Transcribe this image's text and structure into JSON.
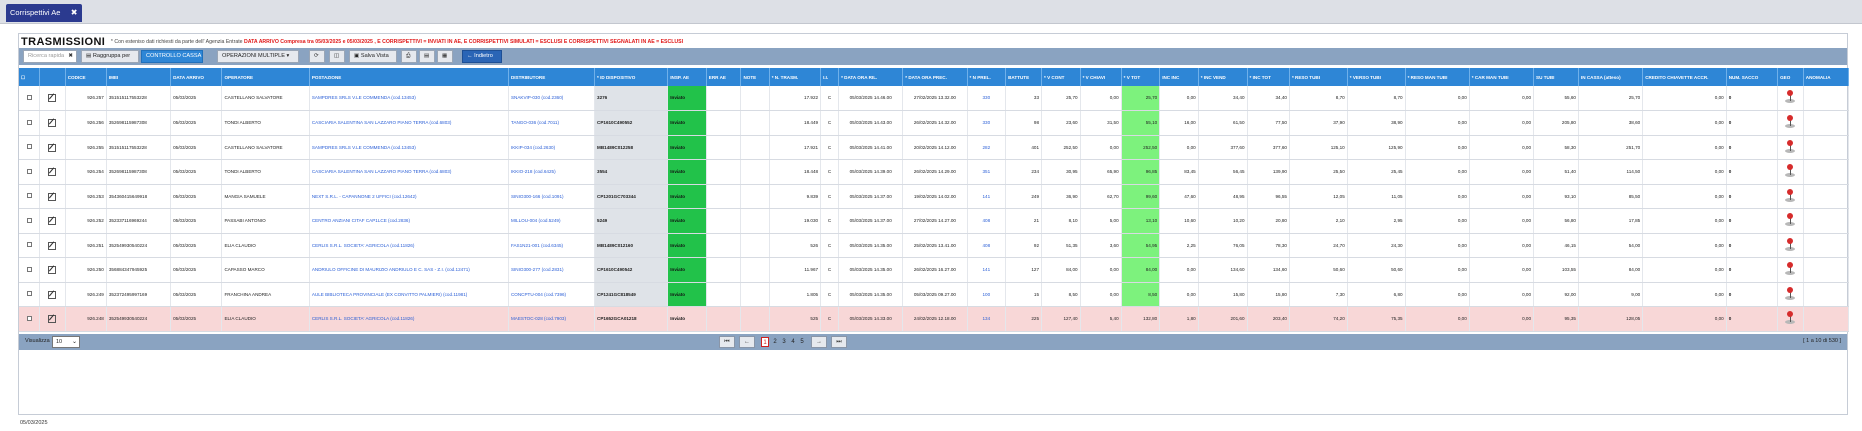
{
  "tab": {
    "label": "Corrispettivi Ae",
    "close": "✖"
  },
  "title": "TRASMISSIONI",
  "subtitle": {
    "prefix": "* Con esteniso dati richiesti da parte dell' Agenzia Entrate",
    "red": "DATA ARRIVO Compresa tra 05/03/2025 e 05/03/2025 , E CORRISPETTIVI = INVIATI IN AE, E CORRISPETTIVI SIMULATI = ESCLUSI E CORRISPETTIVI SEGNALATI IN AE = ESCLUSI"
  },
  "toolbar": {
    "search_placeholder": "Ricerca rapida",
    "search_clear": "✖",
    "group_by": "Raggruppa per",
    "cash_control": "CONTROLLO CASSA",
    "multi_ops": "OPERAZIONI MULTIPLE ▾",
    "refresh": "⟳",
    "columns": "◫",
    "save_view": "Salva Vista",
    "print": "⎙",
    "pdf": "▤",
    "excel": "▦",
    "back": "← Indietro"
  },
  "columns": [
    "☐",
    "",
    "CODICE",
    "IMEI",
    "DATA ARRIVO",
    "OPERATORE",
    "POSTAZIONE",
    "DISTRIBUTORE",
    "* ID DISPOSITIVO",
    "INSP. AE",
    "ERR AE",
    "NOTE",
    "* N. TRASM.",
    "I.I.",
    "* DATA ORA RIL.",
    "* DATA ORA PREC.",
    "* N PREL.",
    "BATTUTE",
    "* V CONT",
    "* V CHIAVI",
    "* V TOT",
    "INC INC",
    "* INC VEND",
    "* INC TOT",
    "* RESO TUBI",
    "* VERSO TUBI",
    "* RESO MAN TUBI",
    "* CAR MAN TUBI",
    "SU TUBI",
    "IN CASSA (atteso)",
    "CREDITO CHIAVETTE ACCR.",
    "NUM. SACCO",
    "GEO",
    "ANOMALIA"
  ],
  "rows": [
    {
      "codice": "926.257",
      "imei": "351515117553228",
      "data": "05/03/2025",
      "operatore": "CASTELLANO SALVATORE",
      "postazione": "SAMPDRES SRLS V.LE COMMENDA (cod.13453)",
      "distributore": "SNAKVIP-030 (cod.2360)",
      "dispositivo": "3276",
      "stato": "Inviato",
      "ntrasm": "17.922",
      "ii": "C",
      "dataril": "05/03/2025 14.46.00",
      "dataprec": "27/02/2025 13.32.00",
      "nprel": "330",
      "battute": "33",
      "vcont": "25,70",
      "vchiavi": "0,00",
      "vtot": "25,70",
      "incinc": "0,00",
      "incvend": "34,40",
      "inctot": "34,40",
      "resotubi": "8,70",
      "versotubi": "8,70",
      "resoman": "0,00",
      "carman": "0,00",
      "sutubi": "55,60",
      "incassa": "25,70",
      "credito": "0,00",
      "sacco": "0"
    },
    {
      "codice": "926.256",
      "imei": "352698115987308",
      "data": "05/03/2025",
      "operatore": "TONDI ALBERTO",
      "postazione": "CASCIARIA SALENTINA SAN LAZZARO PIANO TERRA (cod.6803)",
      "distributore": "TANGO-036 (cod.7011)",
      "dispositivo": "CP1610C490552",
      "stato": "Inviato",
      "ntrasm": "18.449",
      "ii": "C",
      "dataril": "05/03/2025 14.43.00",
      "dataprec": "26/02/2025 14.32.00",
      "nprel": "330",
      "battute": "98",
      "vcont": "23,60",
      "vchiavi": "31,50",
      "vtot": "55,10",
      "incinc": "16,00",
      "incvend": "61,50",
      "inctot": "77,50",
      "resotubi": "37,90",
      "versotubi": "38,90",
      "resoman": "0,00",
      "carman": "0,00",
      "sutubi": "205,80",
      "incassa": "38,60",
      "credito": "0,00",
      "sacco": "0"
    },
    {
      "codice": "926.255",
      "imei": "351515117553228",
      "data": "05/03/2025",
      "operatore": "CASTELLANO SALVATORE",
      "postazione": "SAMPDRES SRLS V.LE COMMENDA (cod.13453)",
      "distributore": "IKKIP-034 (cod.2630)",
      "dispositivo": "MB1489C012258",
      "stato": "Inviato",
      "ntrasm": "17.921",
      "ii": "C",
      "dataril": "05/03/2025 14.41.00",
      "dataprec": "20/02/2025 14.12.00",
      "nprel": "282",
      "battute": "401",
      "vcont": "252,50",
      "vchiavi": "0,00",
      "vtot": "252,50",
      "incinc": "0,00",
      "incvend": "377,60",
      "inctot": "377,60",
      "resotubi": "125,10",
      "versotubi": "125,90",
      "resoman": "0,00",
      "carman": "0,00",
      "sutubi": "58,30",
      "incassa": "251,70",
      "credito": "0,00",
      "sacco": "0"
    },
    {
      "codice": "926.254",
      "imei": "352698115987308",
      "data": "05/03/2025",
      "operatore": "TONDI ALBERTO",
      "postazione": "CASCIARIA SALENTINA SAN LAZZARO PIANO TERRA (cod.6803)",
      "distributore": "IKKIO-218 (cod.6425)",
      "dispositivo": "3554",
      "stato": "Inviato",
      "ntrasm": "18.448",
      "ii": "C",
      "dataril": "05/03/2025 14.39.00",
      "dataprec": "26/02/2025 14.29.00",
      "nprel": "351",
      "battute": "234",
      "vcont": "30,95",
      "vchiavi": "65,90",
      "vtot": "96,85",
      "incinc": "83,45",
      "incvend": "56,45",
      "inctot": "139,90",
      "resotubi": "25,50",
      "versotubi": "25,45",
      "resoman": "0,00",
      "carman": "0,00",
      "sutubi": "51,40",
      "incassa": "114,50",
      "credito": "0,00",
      "sacco": "0"
    },
    {
      "codice": "926.253",
      "imei": "354360415649918",
      "data": "05/03/2025",
      "operatore": "MANGIA SAMUELE",
      "postazione": "NEXT S.R.L. - CAPANNONE 2 UFFICI (cod.12642)",
      "distributore": "SINIO300-166 (cod.1091)",
      "dispositivo": "CP1201GC703344",
      "stato": "Inviato",
      "ntrasm": "9.839",
      "ii": "C",
      "dataril": "05/03/2025 14.37.00",
      "dataprec": "19/02/2025 14.02.00",
      "nprel": "141",
      "battute": "249",
      "vcont": "36,90",
      "vchiavi": "62,70",
      "vtot": "99,60",
      "incinc": "47,60",
      "incvend": "48,95",
      "inctot": "96,55",
      "resotubi": "12,05",
      "versotubi": "11,05",
      "resoman": "0,00",
      "carman": "0,00",
      "sutubi": "93,10",
      "incassa": "85,50",
      "credito": "0,00",
      "sacco": "0"
    },
    {
      "codice": "926.252",
      "imei": "352337116969244",
      "data": "05/03/2025",
      "operatore": "PASSABI ANTONIO",
      "postazione": "CENTRO ANZIANI CITAF CAP1LCE (cod.2836)",
      "distributore": "MILLOU-004 (cod.5249)",
      "dispositivo": "5249",
      "stato": "Inviato",
      "ntrasm": "19.030",
      "ii": "C",
      "dataril": "05/03/2025 14.37.00",
      "dataprec": "27/02/2025 14.27.00",
      "nprel": "408",
      "battute": "21",
      "vcont": "8,10",
      "vchiavi": "5,00",
      "vtot": "13,10",
      "incinc": "10,60",
      "incvend": "10,20",
      "inctot": "20,80",
      "resotubi": "2,10",
      "versotubi": "2,95",
      "resoman": "0,00",
      "carman": "0,00",
      "sutubi": "56,80",
      "incassa": "17,85",
      "credito": "0,00",
      "sacco": "0"
    },
    {
      "codice": "926.251",
      "imei": "352549930540224",
      "data": "05/03/2025",
      "operatore": "ELIA CLAUDIO",
      "postazione": "CERLIS S.R.L. SOCIETA' AGRICOLA (cod.11826)",
      "distributore": "FAS1N21-001 (cod.6345)",
      "dispositivo": "MB1489C012160",
      "stato": "Inviato",
      "ntrasm": "526",
      "ii": "C",
      "dataril": "05/03/2025 14.35.00",
      "dataprec": "25/02/2025 13.41.00",
      "nprel": "408",
      "battute": "92",
      "vcont": "51,35",
      "vchiavi": "3,60",
      "vtot": "54,95",
      "incinc": "2,25",
      "incvend": "76,05",
      "inctot": "78,30",
      "resotubi": "24,70",
      "versotubi": "24,30",
      "resoman": "0,00",
      "carman": "0,00",
      "sutubi": "46,15",
      "incassa": "54,00",
      "credito": "0,00",
      "sacco": "0"
    },
    {
      "codice": "926.250",
      "imei": "356884347945925",
      "data": "05/03/2025",
      "operatore": "CAPASSO MARCO",
      "postazione": "ANDRIULO OFFICINE DI MAURIZIO ANDRIULO E C. SAS - Z.I. (cod.12471)",
      "distributore": "SINIO300-277 (cod.2831)",
      "dispositivo": "CP1610C490542",
      "stato": "Inviato",
      "ntrasm": "11.967",
      "ii": "C",
      "dataril": "05/03/2025 14.35.00",
      "dataprec": "26/02/2025 16.27.00",
      "nprel": "141",
      "battute": "127",
      "vcont": "84,00",
      "vchiavi": "0,00",
      "vtot": "84,00",
      "incinc": "0,00",
      "incvend": "134,60",
      "inctot": "134,60",
      "resotubi": "50,60",
      "versotubi": "50,60",
      "resoman": "0,00",
      "carman": "0,00",
      "sutubi": "103,55",
      "incassa": "84,00",
      "credito": "0,00",
      "sacco": "0"
    },
    {
      "codice": "926.249",
      "imei": "352372495997169",
      "data": "05/03/2025",
      "operatore": "FRANCHINA ANDREA",
      "postazione": "AULE BIBLIOTECA PROVINCIALE (EX CONVITTO PALMIERI) (cod.11981)",
      "distributore": "CONCPTU-004 (cod.7396)",
      "dispositivo": "CP1241GC818549",
      "stato": "Inviato",
      "ntrasm": "1.805",
      "ii": "C",
      "dataril": "05/03/2025 14.35.00",
      "dataprec": "05/03/2025 09.27.00",
      "nprel": "100",
      "battute": "15",
      "vcont": "8,50",
      "vchiavi": "0,00",
      "vtot": "8,50",
      "incinc": "0,00",
      "incvend": "15,80",
      "inctot": "15,80",
      "resotubi": "7,30",
      "versotubi": "6,80",
      "resoman": "0,00",
      "carman": "0,00",
      "sutubi": "92,00",
      "incassa": "9,00",
      "credito": "0,00",
      "sacco": "0"
    },
    {
      "codice": "926.248",
      "imei": "352549930540224",
      "data": "05/03/2025",
      "operatore": "ELIA CLAUDIO",
      "postazione": "CERLIS S.R.L. SOCIETA' AGRICOLA (cod.11826)",
      "distributore": "MAESTOC-028 (cod.7903)",
      "dispositivo": "CP1652GCA01218",
      "stato": "Inviato",
      "ntrasm": "525",
      "ii": "C",
      "dataril": "05/03/2025 14.33.00",
      "dataprec": "24/02/2025 12.18.00",
      "nprel": "134",
      "battute": "225",
      "vcont": "127,40",
      "vchiavi": "5,40",
      "vtot": "132,80",
      "incinc": "1,80",
      "incvend": "201,60",
      "inctot": "203,40",
      "resotubi": "74,20",
      "versotubi": "75,35",
      "resoman": "0,00",
      "carman": "0,00",
      "sutubi": "95,35",
      "incassa": "128,05",
      "credito": "0,00",
      "sacco": "0"
    }
  ],
  "footer": {
    "per_page_label": "Visualizza",
    "per_page_value": "10",
    "first": "⏮",
    "prev": "←",
    "pages": [
      "1",
      "2",
      "3",
      "4",
      "5"
    ],
    "next": "→",
    "last": "⏭",
    "records_info": "[ 1 a 10 di 530 ]"
  },
  "date_footer": "05/03/2025"
}
